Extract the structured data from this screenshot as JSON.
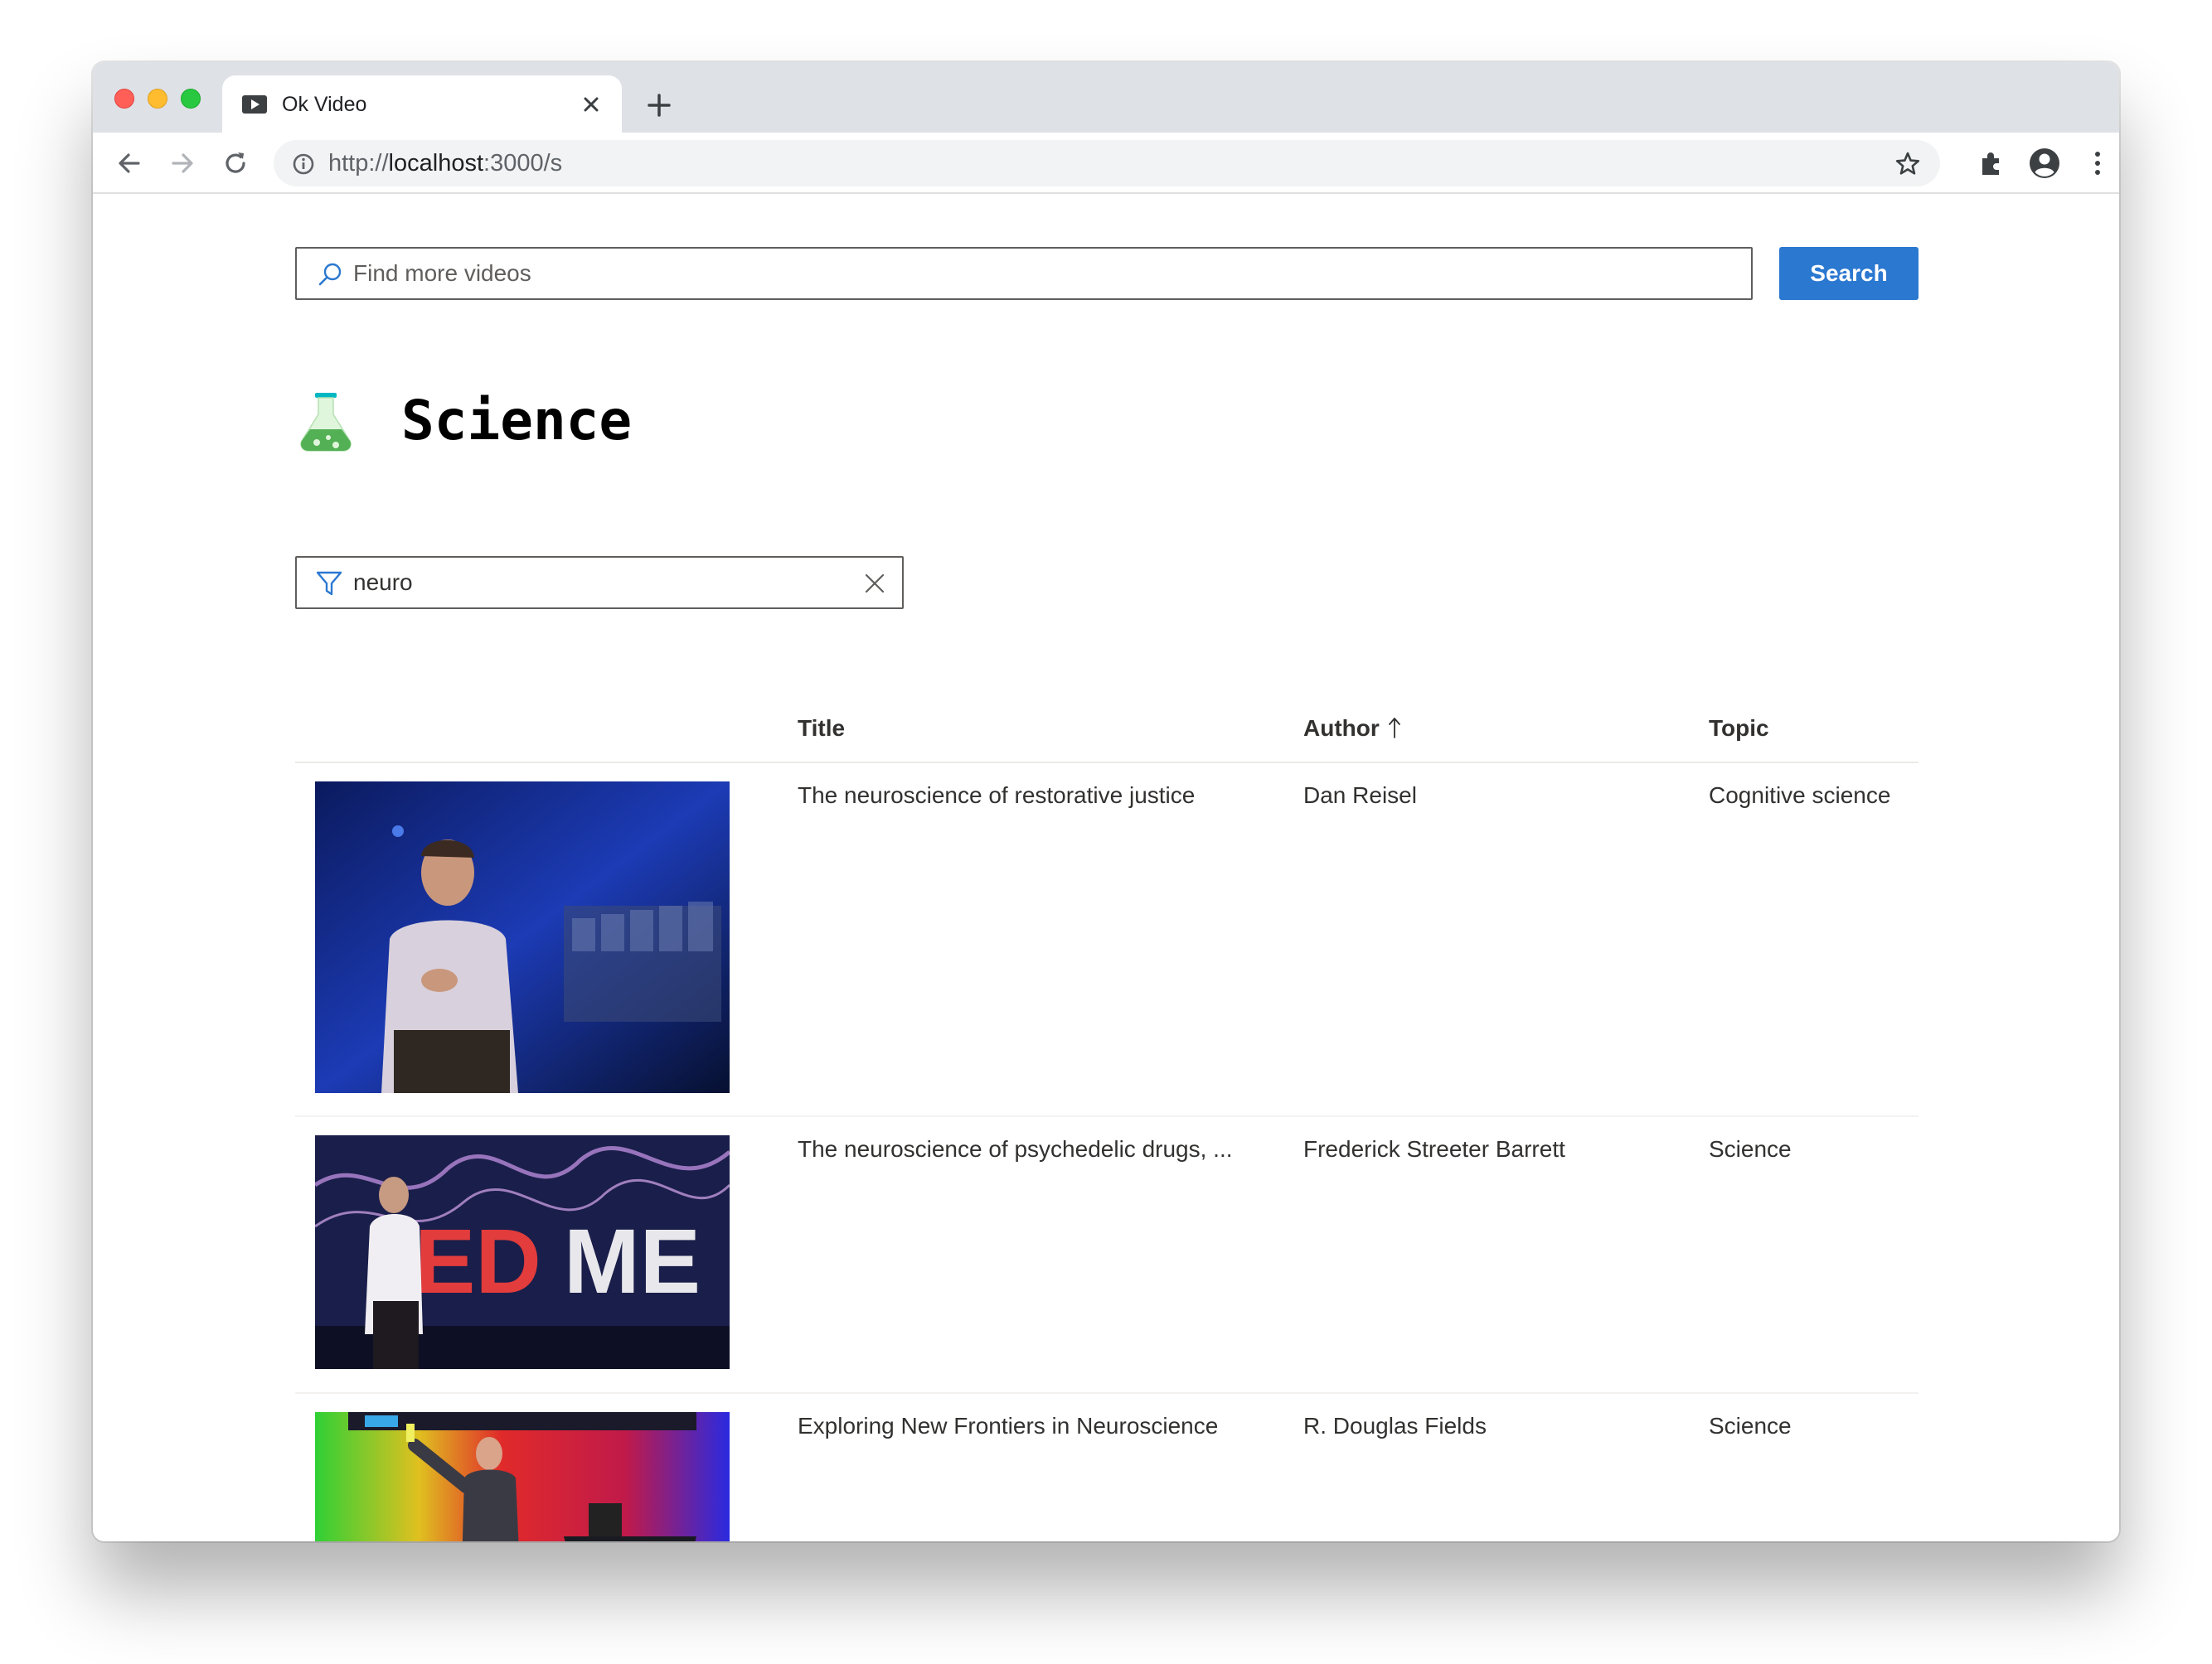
{
  "browser": {
    "tab_title": "Ok Video",
    "url_prefix": "http://",
    "url_host": "localhost",
    "url_suffix": ":3000/s"
  },
  "search": {
    "placeholder": "Find more videos",
    "value": "",
    "button_label": "Search"
  },
  "page": {
    "title": "Science",
    "icon": "flask-icon"
  },
  "filter": {
    "value": "neuro",
    "placeholder": ""
  },
  "table": {
    "columns": [
      {
        "key": "thumbnail",
        "label": ""
      },
      {
        "key": "title",
        "label": "Title"
      },
      {
        "key": "author",
        "label": "Author",
        "sort": "ascending"
      },
      {
        "key": "topic",
        "label": "Topic"
      }
    ],
    "rows": [
      {
        "title": "The neuroscience of restorative justice",
        "author": "Dan Reisel",
        "topic": "Cognitive science",
        "thumbnail": "speaker on blue stage"
      },
      {
        "title": "The neuroscience of psychedelic drugs, ...",
        "author": "Frederick Streeter Barrett",
        "topic": "Science",
        "thumbnail": "speaker in front of TEDMED letters"
      },
      {
        "title": "Exploring New Frontiers in Neuroscience",
        "author": "R. Douglas Fields",
        "topic": "Science",
        "thumbnail": "speaker on colorful stage"
      }
    ]
  },
  "colors": {
    "primary_button": "#2b78d0",
    "text": "#323130",
    "border": "#605e5c"
  }
}
